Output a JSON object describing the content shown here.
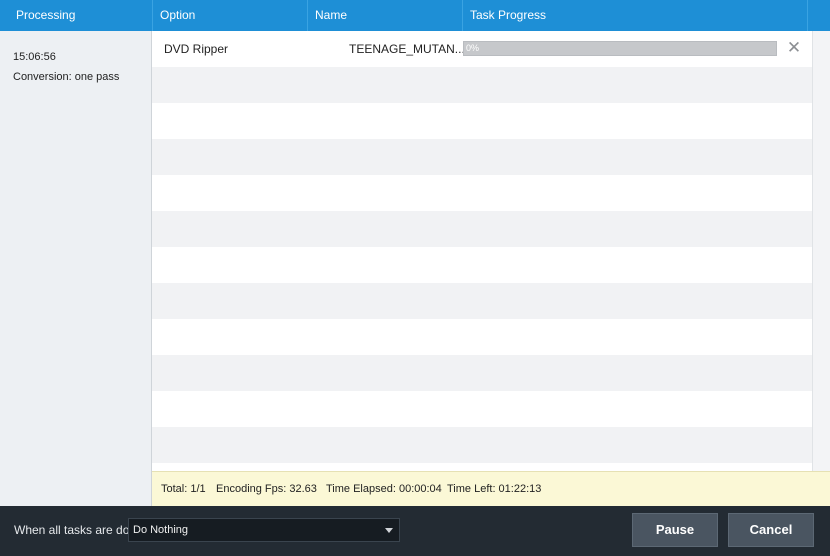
{
  "header": {
    "processing": "Processing",
    "option": "Option",
    "name": "Name",
    "task_progress": "Task Progress"
  },
  "left_panel": {
    "time": "15:06:56",
    "mode": "Conversion: one pass"
  },
  "tasks": [
    {
      "option": "DVD Ripper",
      "name": "TEENAGE_MUTAN...",
      "progress_label": "0%",
      "progress_fraction": 0.0
    }
  ],
  "status": {
    "total": "Total: 1/1",
    "fps": "Encoding Fps: 32.63",
    "elapsed": "Time Elapsed: 00:00:04",
    "left": "Time Left: 01:22:13"
  },
  "footer": {
    "when_done_label": "When all tasks are done:",
    "when_done_value": "Do Nothing",
    "pause_label": "Pause",
    "cancel_label": "Cancel"
  },
  "colors": {
    "header_blue": "#1e8fd6",
    "footer_dark": "#232b33",
    "status_yellow": "#fbf8d6",
    "button_gray": "#4a5561"
  },
  "icons": {
    "remove_task": "close-icon",
    "dropdown": "chevron-down-icon"
  }
}
